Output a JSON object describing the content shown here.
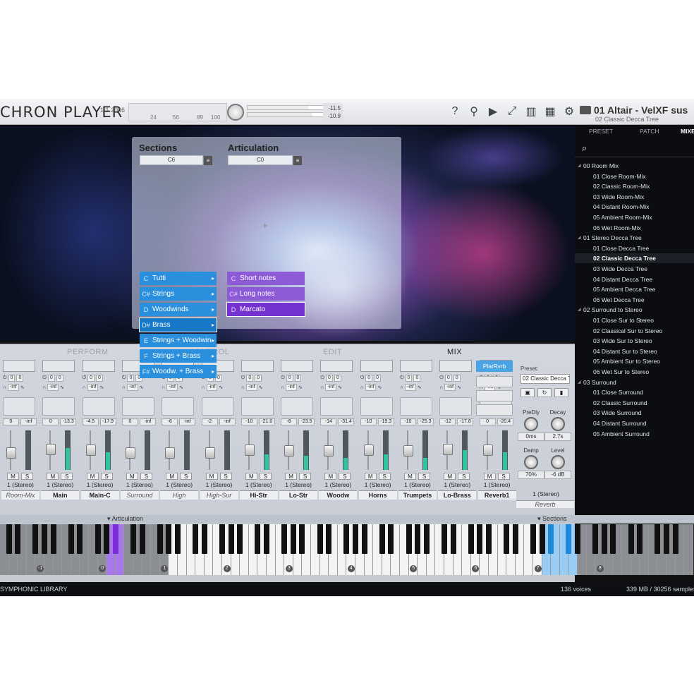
{
  "app": {
    "title": "CHRON PLAYER",
    "version": "1.1.2046",
    "ruler_marks": [
      "24",
      "56",
      "89",
      "100"
    ],
    "peak_top": "-11.5",
    "peak_bottom": "-10.9",
    "patch_name": "01 Altair - VelXF sus",
    "patch_sub": "02 Classic Decca Tree",
    "tools": [
      "help-icon",
      "location-pin-icon",
      "play-icon",
      "expand-icon",
      "keyboard-icon",
      "chip-icon",
      "gear-icon"
    ]
  },
  "sections": {
    "title": "Sections",
    "key": "C6",
    "items": [
      {
        "key": "C",
        "label": "Tutti"
      },
      {
        "key": "C#",
        "label": "Strings"
      },
      {
        "key": "D",
        "label": "Woodwinds"
      },
      {
        "key": "D#",
        "label": "Brass"
      },
      {
        "key": "E",
        "label": "Strings + Woodwinds"
      },
      {
        "key": "F",
        "label": "Strings + Brass"
      },
      {
        "key": "F#",
        "label": "Woodw. + Brass"
      }
    ]
  },
  "articulation": {
    "title": "Articulation",
    "key": "C0",
    "items": [
      {
        "key": "C",
        "label": "Short notes"
      },
      {
        "key": "C#",
        "label": "Long notes"
      },
      {
        "key": "D",
        "label": "Marcato"
      }
    ]
  },
  "mixer": {
    "tabs": [
      "PERFORM",
      "CONTROL",
      "EDIT",
      "MIX"
    ],
    "strips": [
      {
        "name": "Room-Mix",
        "italic": true,
        "out": "1 (Stereo)",
        "v1": "0",
        "v2": "-inf",
        "level": 0
      },
      {
        "name": "Main",
        "italic": false,
        "out": "1 (Stereo)",
        "v1": "0",
        "v2": "-13.3",
        "level": 0.55
      },
      {
        "name": "Main-C",
        "italic": false,
        "out": "1 (Stereo)",
        "v1": "-4.5",
        "v2": "-17.9",
        "level": 0.45
      },
      {
        "name": "Surround",
        "italic": true,
        "out": "1 (Stereo)",
        "v1": "0",
        "v2": "-inf",
        "level": 0
      },
      {
        "name": "High",
        "italic": true,
        "out": "1 (Stereo)",
        "v1": "-6",
        "v2": "-inf",
        "level": 0
      },
      {
        "name": "High-Sur",
        "italic": true,
        "out": "1 (Stereo)",
        "v1": "-2",
        "v2": "-inf",
        "level": 0
      },
      {
        "name": "Hi-Str",
        "italic": false,
        "out": "1 (Stereo)",
        "v1": "-10",
        "v2": "-21.0",
        "level": 0.4
      },
      {
        "name": "Lo-Str",
        "italic": false,
        "out": "1 (Stereo)",
        "v1": "-8",
        "v2": "-23.5",
        "level": 0.35
      },
      {
        "name": "Woodw",
        "italic": false,
        "out": "1 (Stereo)",
        "v1": "-14",
        "v2": "-31.4",
        "level": 0.3
      },
      {
        "name": "Horns",
        "italic": false,
        "out": "1 (Stereo)",
        "v1": "-10",
        "v2": "-19.3",
        "level": 0.4
      },
      {
        "name": "Trumpets",
        "italic": false,
        "out": "1 (Stereo)",
        "v1": "-10",
        "v2": "-25.3",
        "level": 0.3
      },
      {
        "name": "Lo-Brass",
        "italic": false,
        "out": "1 (Stereo)",
        "v1": "-12",
        "v2": "-17.8",
        "level": 0.5
      },
      {
        "name": "Reverb1",
        "italic": false,
        "out": "1 (Stereo)",
        "v1": "0",
        "v2": "-20.4",
        "level": 0.45
      }
    ],
    "reverb": {
      "plugin": "PlatRvrb",
      "preset_label": "Preset:",
      "preset": "02 Classic Decca Tree",
      "out": "1 (Stereo)",
      "name": "Reverb",
      "knobs": [
        {
          "label": "PreDly",
          "value": "0ms"
        },
        {
          "label": "Decay",
          "value": "2.7s"
        },
        {
          "label": "Damp",
          "value": "70%"
        },
        {
          "label": "Level",
          "value": "-6 dB"
        }
      ]
    }
  },
  "browser": {
    "tabs": [
      "PRESET",
      "PATCH",
      "MIXER"
    ],
    "items": [
      {
        "label": "00 Room Mix",
        "type": "f"
      },
      {
        "label": "01 Close Room-Mix",
        "type": "p"
      },
      {
        "label": "02 Classic Room-Mix",
        "type": "p"
      },
      {
        "label": "03 Wide Room-Mix",
        "type": "p"
      },
      {
        "label": "04 Distant Room-Mix",
        "type": "p"
      },
      {
        "label": "05 Ambient Room-Mix",
        "type": "p"
      },
      {
        "label": "06 Wet Room-Mix",
        "type": "p"
      },
      {
        "label": "01 Stereo Decca Tree",
        "type": "f"
      },
      {
        "label": "01 Close Decca Tree",
        "type": "p"
      },
      {
        "label": "02 Classic Decca Tree",
        "type": "p",
        "selected": true
      },
      {
        "label": "03 Wide Decca Tree",
        "type": "p"
      },
      {
        "label": "04 Distant Decca Tree",
        "type": "p"
      },
      {
        "label": "05 Ambient Decca Tree",
        "type": "p"
      },
      {
        "label": "06 Wet Decca Tree",
        "type": "p"
      },
      {
        "label": "02 Surround to Stereo",
        "type": "f"
      },
      {
        "label": "01 Close Sur to Stereo",
        "type": "p"
      },
      {
        "label": "02 Classical Sur to Stereo",
        "type": "p"
      },
      {
        "label": "03 Wide Sur to Stereo",
        "type": "p"
      },
      {
        "label": "04 Distant Sur to Stereo",
        "type": "p"
      },
      {
        "label": "05 Ambient Sur to Stereo",
        "type": "p"
      },
      {
        "label": "06 Wet Sur to Stereo",
        "type": "p"
      },
      {
        "label": "03 Surround",
        "type": "f"
      },
      {
        "label": "01 Close Surround",
        "type": "p"
      },
      {
        "label": "02 Classic Surround",
        "type": "p"
      },
      {
        "label": "03 Wide Surround",
        "type": "p"
      },
      {
        "label": "04 Distant Surround",
        "type": "p"
      },
      {
        "label": "05 Ambient Surround",
        "type": "p"
      }
    ]
  },
  "keyboard": {
    "articulation_label": "▾ Articulation",
    "sections_label": "▾ Sections",
    "octaves": [
      "-1",
      "0",
      "1",
      "2",
      "3",
      "4",
      "5",
      "6",
      "7",
      "8"
    ]
  },
  "status": {
    "library": "SYMPHONIC LIBRARY",
    "voices": "136 voices",
    "memory": "339 MB / 30256 samples"
  }
}
